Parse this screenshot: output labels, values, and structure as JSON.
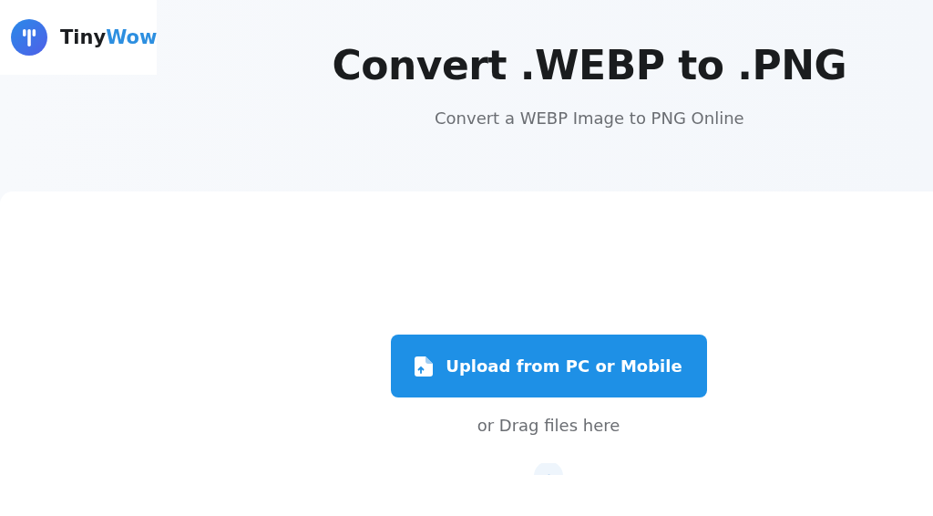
{
  "logo": {
    "name": "Tiny",
    "name_accent": "Wow"
  },
  "title": "Convert .WEBP to .PNG",
  "subtitle": "Convert a WEBP Image to PNG Online",
  "upload_button": "Upload from PC or Mobile",
  "drag_hint": "or Drag files here"
}
